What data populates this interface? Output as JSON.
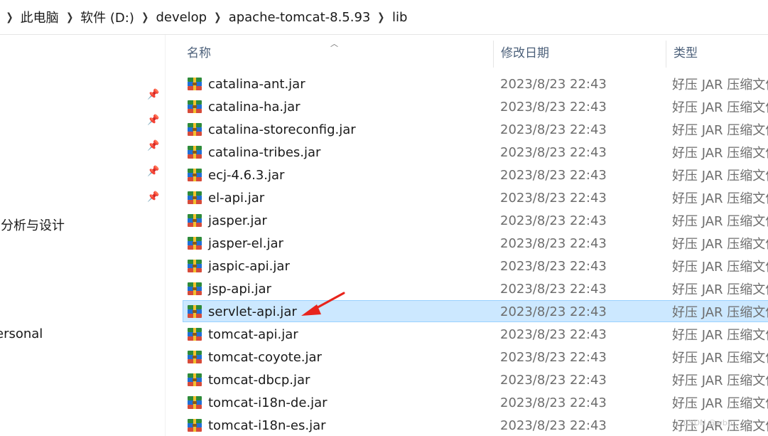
{
  "breadcrumb": {
    "items": [
      "此电脑",
      "软件 (D:)",
      "develop",
      "apache-tomcat-8.5.93",
      "lib"
    ]
  },
  "nav": {
    "pins": 5,
    "texts": [
      "]分析与设计",
      "l",
      "ersonal"
    ]
  },
  "columns": {
    "name": "名称",
    "date": "修改日期",
    "type": "类型"
  },
  "files": [
    {
      "name": "catalina-ant.jar",
      "date": "2023/8/23 22:43",
      "type": "好压 JAR 压缩文件"
    },
    {
      "name": "catalina-ha.jar",
      "date": "2023/8/23 22:43",
      "type": "好压 JAR 压缩文件"
    },
    {
      "name": "catalina-storeconfig.jar",
      "date": "2023/8/23 22:43",
      "type": "好压 JAR 压缩文件"
    },
    {
      "name": "catalina-tribes.jar",
      "date": "2023/8/23 22:43",
      "type": "好压 JAR 压缩文件"
    },
    {
      "name": "ecj-4.6.3.jar",
      "date": "2023/8/23 22:43",
      "type": "好压 JAR 压缩文件"
    },
    {
      "name": "el-api.jar",
      "date": "2023/8/23 22:43",
      "type": "好压 JAR 压缩文件"
    },
    {
      "name": "jasper.jar",
      "date": "2023/8/23 22:43",
      "type": "好压 JAR 压缩文件"
    },
    {
      "name": "jasper-el.jar",
      "date": "2023/8/23 22:43",
      "type": "好压 JAR 压缩文件"
    },
    {
      "name": "jaspic-api.jar",
      "date": "2023/8/23 22:43",
      "type": "好压 JAR 压缩文件"
    },
    {
      "name": "jsp-api.jar",
      "date": "2023/8/23 22:43",
      "type": "好压 JAR 压缩文件"
    },
    {
      "name": "servlet-api.jar",
      "date": "2023/8/23 22:43",
      "type": "好压 JAR 压缩文件",
      "selected": true
    },
    {
      "name": "tomcat-api.jar",
      "date": "2023/8/23 22:43",
      "type": "好压 JAR 压缩文件"
    },
    {
      "name": "tomcat-coyote.jar",
      "date": "2023/8/23 22:43",
      "type": "好压 JAR 压缩文件"
    },
    {
      "name": "tomcat-dbcp.jar",
      "date": "2023/8/23 22:43",
      "type": "好压 JAR 压缩文件"
    },
    {
      "name": "tomcat-i18n-de.jar",
      "date": "2023/8/23 22:43",
      "type": "好压 JAR 压缩文件"
    },
    {
      "name": "tomcat-i18n-es.jar",
      "date": "2023/8/23 22:43",
      "type": "好压 JAR 压缩文件"
    }
  ],
  "colors": {
    "selection_bg": "#cce8ff",
    "selection_border": "#99d1ff",
    "arrow": "#e8241c"
  },
  "watermark": "CSDN @wbp..."
}
